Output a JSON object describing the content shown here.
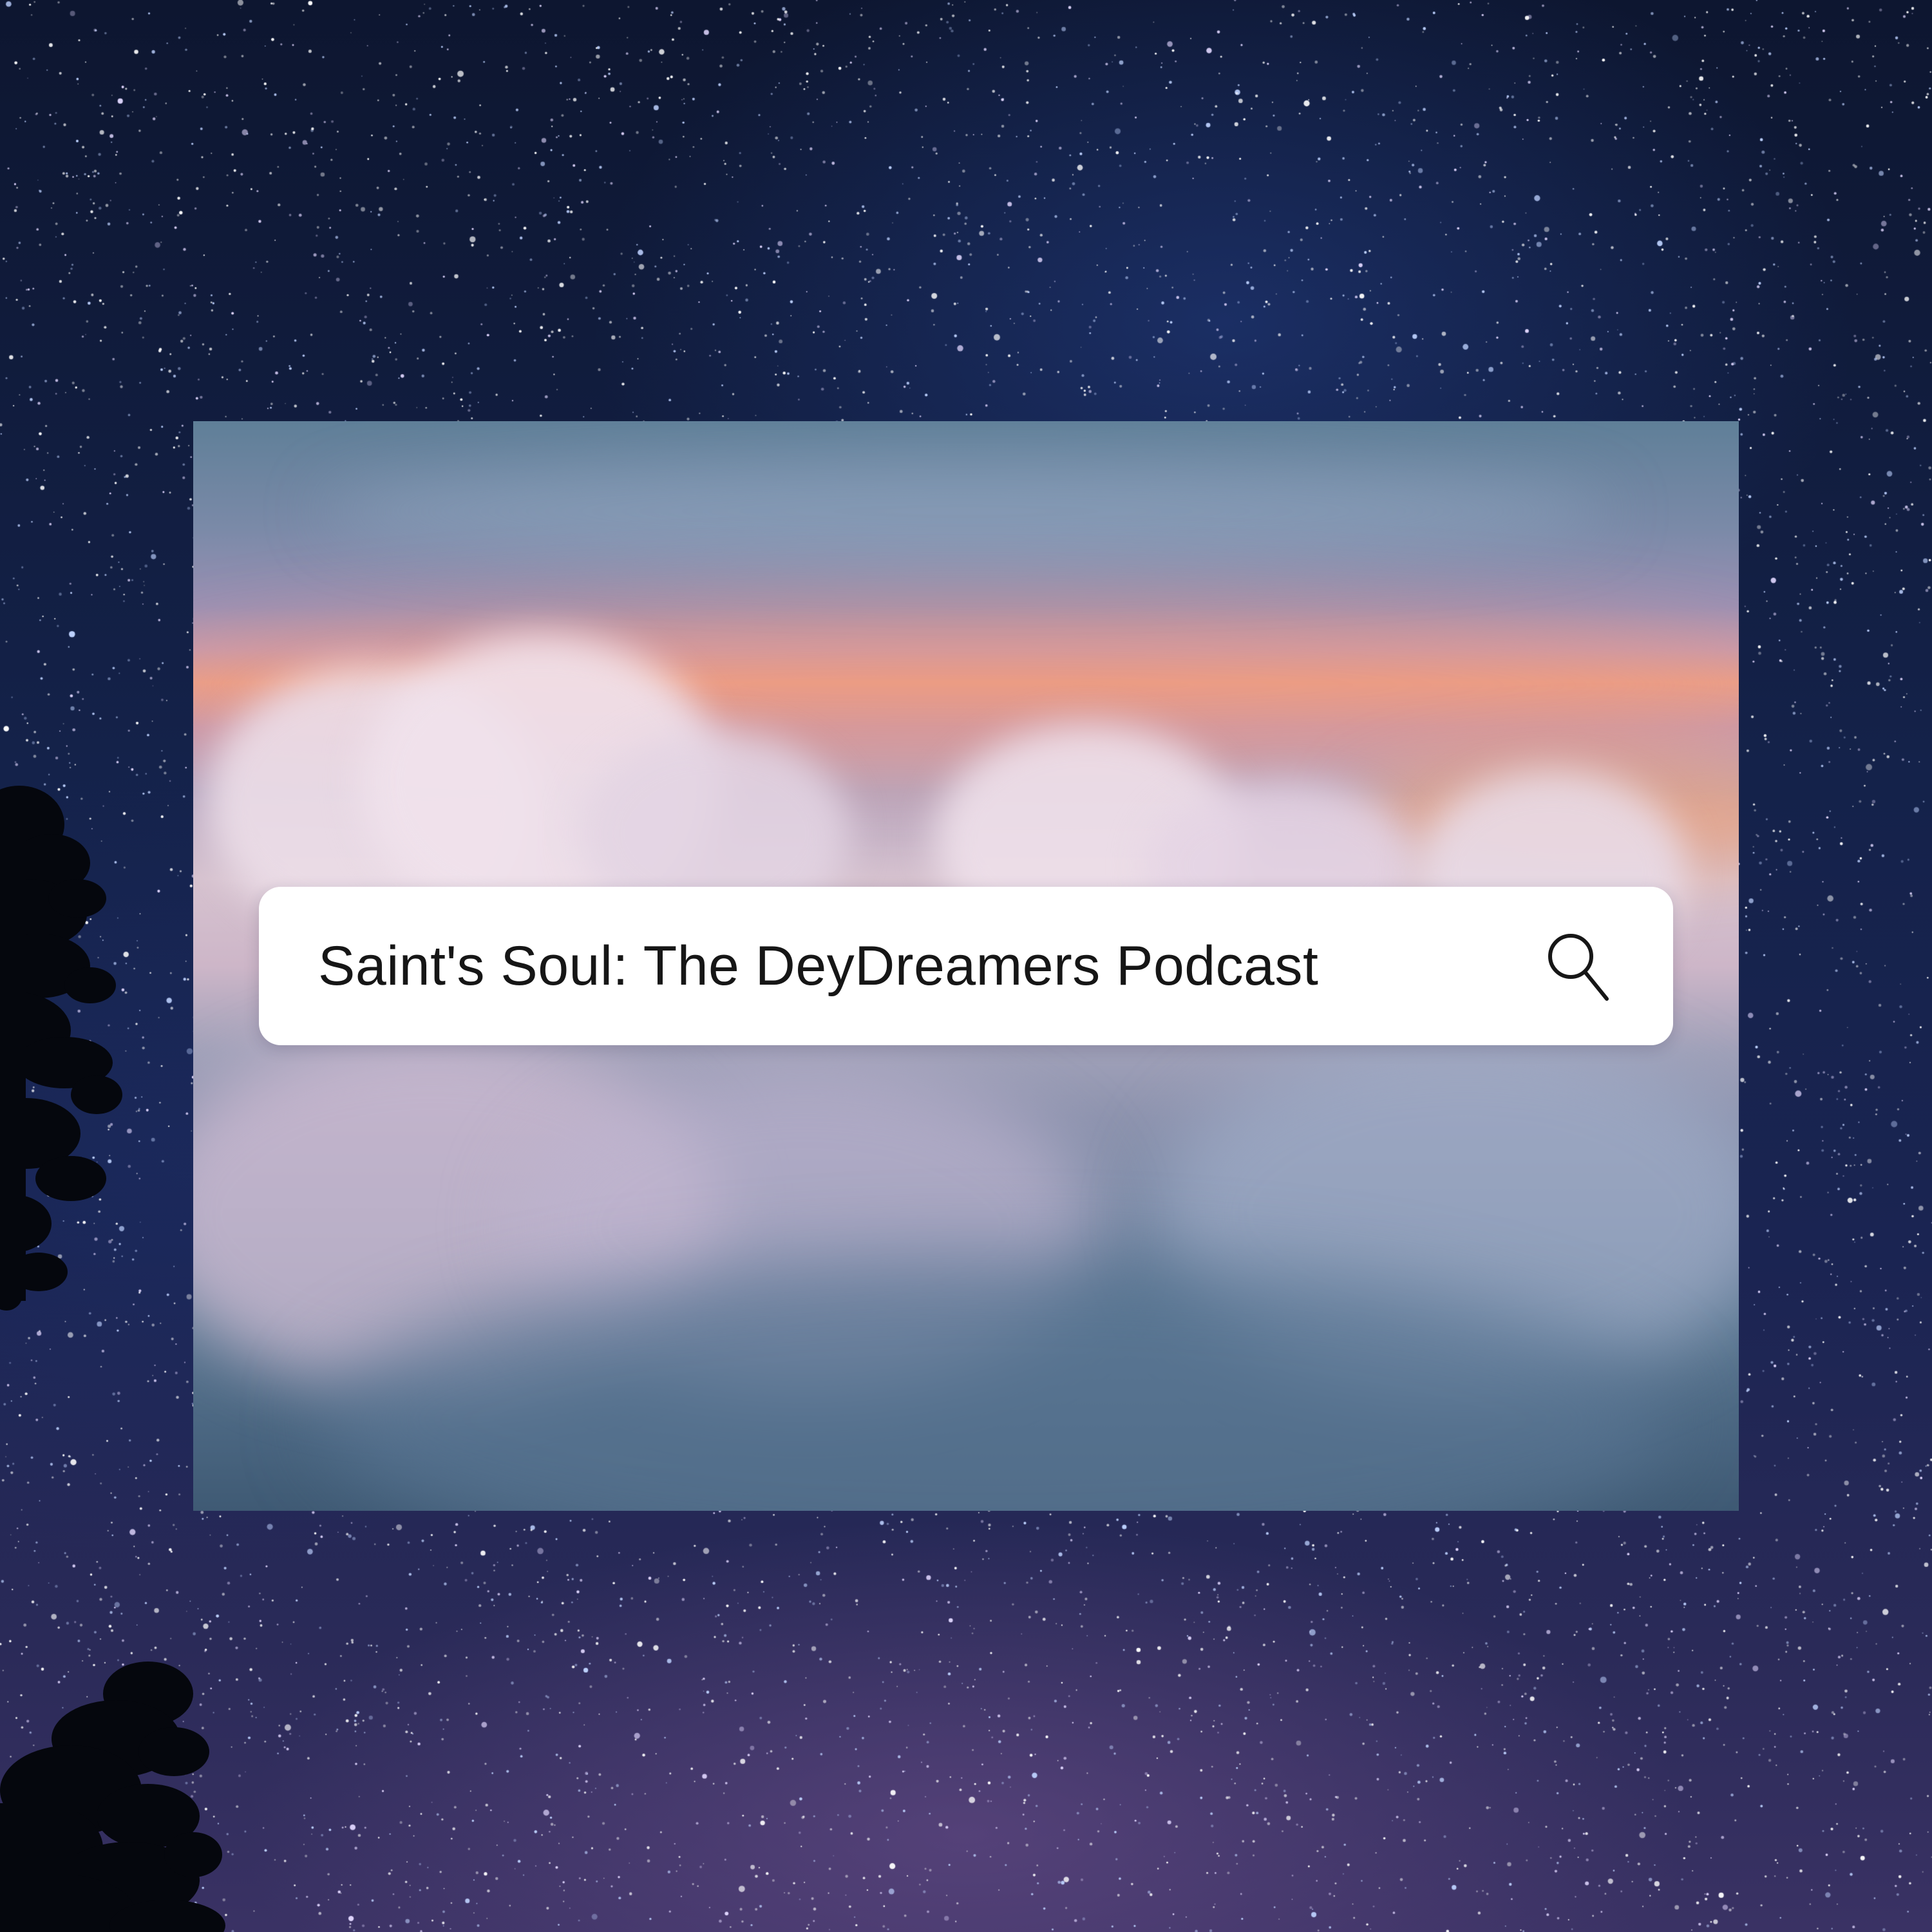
{
  "search": {
    "query": "Saint's Soul: The DeyDreamers Podcast",
    "icon": "search-icon"
  },
  "colors": {
    "night_sky": "#14224a",
    "search_bar": "#ffffff",
    "search_text": "#161616",
    "sunset_glow": "#e8a08e"
  }
}
